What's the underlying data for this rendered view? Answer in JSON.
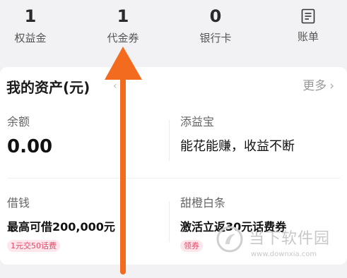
{
  "top_stats": [
    {
      "value": "1",
      "label": "权益金"
    },
    {
      "value": "1",
      "label": "代金券"
    },
    {
      "value": "0",
      "label": "银行卡"
    },
    {
      "label": "账单",
      "icon": "bill-icon"
    }
  ],
  "assets": {
    "title": "我的资产(元)",
    "more": "更多",
    "balance_label": "余额",
    "balance_value": "0.00",
    "tianyibao_label": "添益宝",
    "tianyibao_slogan": "能花能赚，收益不断",
    "borrow_label": "借钱",
    "borrow_line": "最高可借200,000元",
    "borrow_badge": "1元交50话费",
    "tiancheng_label": "甜橙白条",
    "tiancheng_line": "激活立返30元话费券",
    "tiancheng_badge": "领券"
  },
  "watermark": {
    "title": "当下软件园",
    "url": "www.downxia.com"
  },
  "colors": {
    "arrow": "#f26b1f",
    "badge_bg": "#fde7ec",
    "badge_text": "#e34866"
  }
}
